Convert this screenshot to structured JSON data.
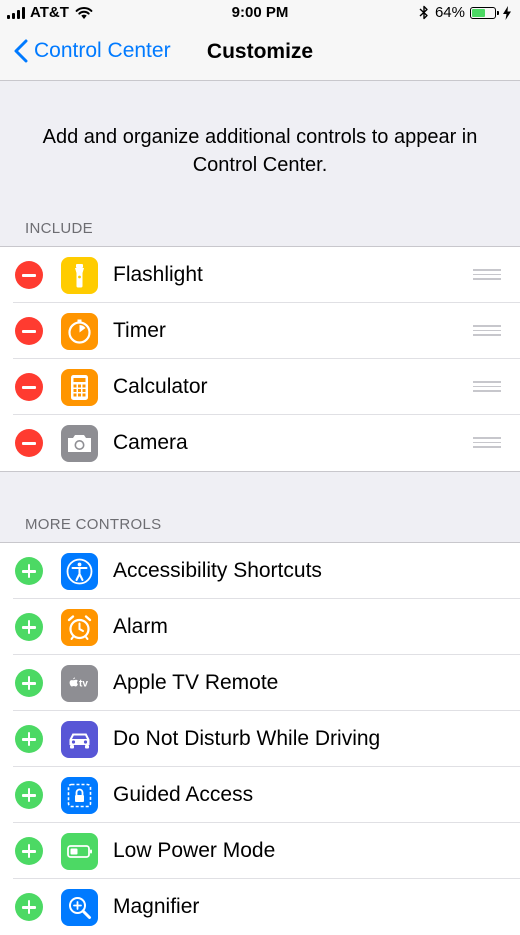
{
  "status_bar": {
    "carrier": "AT&T",
    "time": "9:00 PM",
    "battery_percent": "64%",
    "battery_level": 0.64,
    "icons": [
      "signal-icon",
      "wifi-icon",
      "bluetooth-icon",
      "battery-icon",
      "charging-bolt-icon"
    ]
  },
  "nav": {
    "back_label": "Control Center",
    "title": "Customize"
  },
  "description": "Add and organize additional controls to appear in Control Center.",
  "include": {
    "header": "INCLUDE",
    "items": [
      {
        "label": "Flashlight",
        "icon": "flashlight-icon",
        "color": "#ffcc00"
      },
      {
        "label": "Timer",
        "icon": "timer-icon",
        "color": "#ff9500"
      },
      {
        "label": "Calculator",
        "icon": "calculator-icon",
        "color": "#ff9500"
      },
      {
        "label": "Camera",
        "icon": "camera-icon",
        "color": "#8e8e93"
      }
    ]
  },
  "more_controls": {
    "header": "MORE CONTROLS",
    "items": [
      {
        "label": "Accessibility Shortcuts",
        "icon": "accessibility-icon",
        "color": "#007aff"
      },
      {
        "label": "Alarm",
        "icon": "alarm-icon",
        "color": "#ff9500"
      },
      {
        "label": "Apple TV Remote",
        "icon": "apple-tv-icon",
        "color": "#8e8e93"
      },
      {
        "label": "Do Not Disturb While Driving",
        "icon": "car-icon",
        "color": "#5856d6"
      },
      {
        "label": "Guided Access",
        "icon": "lock-icon",
        "color": "#007aff"
      },
      {
        "label": "Low Power Mode",
        "icon": "battery-icon",
        "color": "#4cd964"
      },
      {
        "label": "Magnifier",
        "icon": "magnifier-icon",
        "color": "#007aff"
      }
    ]
  },
  "colors": {
    "accent": "#007aff",
    "remove": "#ff3b30",
    "add": "#4cd964",
    "background": "#efeff4"
  }
}
